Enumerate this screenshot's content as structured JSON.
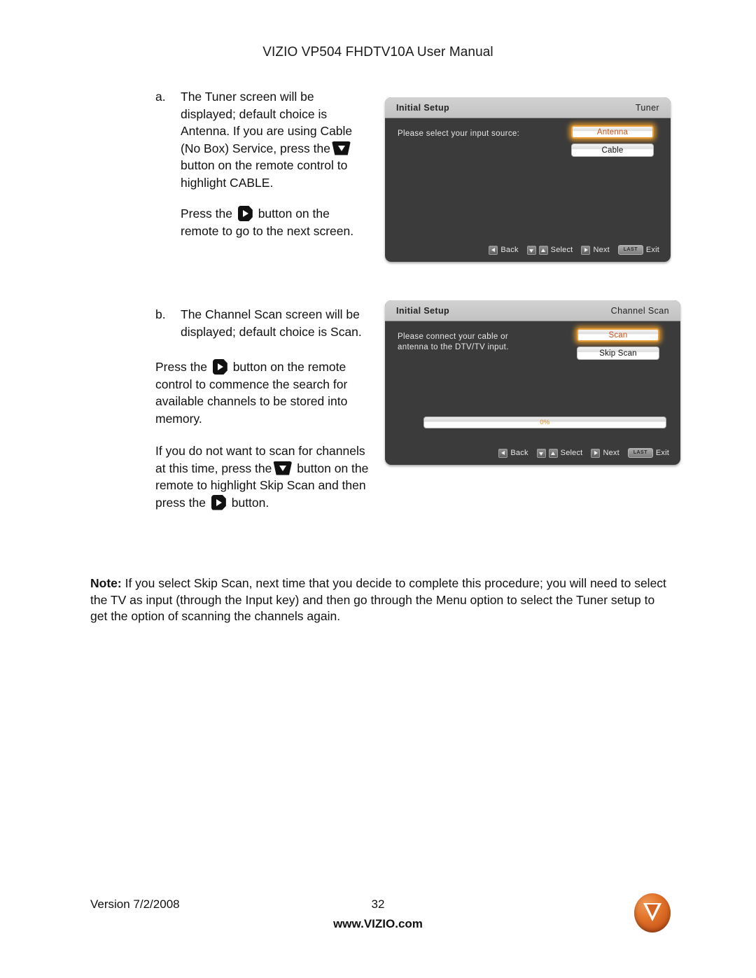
{
  "header": {
    "title": "VIZIO VP504 FHDTV10A User Manual"
  },
  "instructions": {
    "a": {
      "marker": "a.",
      "line1_before": "The Tuner screen will be displayed; default choice is Antenna.  If you are using Cable (No Box) Service, press the",
      "icon1": "down-arrow-key-icon",
      "line1_after": "button on the remote control to highlight CABLE.",
      "line2_before": "Press the",
      "icon2": "right-arrow-key-icon",
      "line2_after": "button on the remote to go to the next screen."
    },
    "b": {
      "marker": "b.",
      "line1": "The Channel Scan screen will be displayed; default choice is Scan.",
      "p1_before": "Press the",
      "p1_icon": "right-arrow-key-icon",
      "p1_after": "button on the remote control to commence the search for available channels to be stored into memory.",
      "p2_before": "If you do not want to scan for channels at this time, press the",
      "p2_icon": "down-arrow-key-icon",
      "p2_mid": "button on the remote to highlight Skip Scan and then press the",
      "p2_icon2": "right-arrow-key-icon",
      "p2_after": "button."
    }
  },
  "osd_tuner": {
    "title_left": "Initial Setup",
    "title_right": "Tuner",
    "prompt": "Please select your input source:",
    "choices": [
      {
        "label": "Antenna",
        "selected": true
      },
      {
        "label": "Cable",
        "selected": false
      }
    ],
    "nav": [
      {
        "icon": "left-arrow-key-icon",
        "label": "Back"
      },
      {
        "icon": "down-up-arrow-keys-icon",
        "label": "Select"
      },
      {
        "icon": "right-arrow-key-icon",
        "label": "Next"
      },
      {
        "icon": "last-key-icon",
        "label": "Exit",
        "key_text": "LAST"
      }
    ]
  },
  "osd_channel_scan": {
    "title_left": "Initial Setup",
    "title_right": "Channel Scan",
    "prompt_line1": "Please connect your cable or",
    "prompt_line2": "antenna to the DTV/TV input.",
    "choices": [
      {
        "label": "Scan",
        "selected": true
      },
      {
        "label": "Skip Scan",
        "selected": false
      }
    ],
    "progress": {
      "label": "0%",
      "percent": 0
    },
    "nav": [
      {
        "icon": "left-arrow-key-icon",
        "label": "Back"
      },
      {
        "icon": "down-up-arrow-keys-icon",
        "label": "Select"
      },
      {
        "icon": "right-arrow-key-icon",
        "label": "Next"
      },
      {
        "icon": "last-key-icon",
        "label": "Exit",
        "key_text": "LAST"
      }
    ]
  },
  "note": {
    "label": "Note:",
    "text": " If you select Skip Scan, next time that you decide to complete this procedure; you will need to select the TV as input (through the Input key) and then go through the Menu option to select the Tuner setup to get the option of scanning the channels again."
  },
  "footer": {
    "version": "Version 7/2/2008",
    "page_number": "32",
    "website": "www.VIZIO.com",
    "logo": "vizio-logo-icon"
  },
  "colors": {
    "accent_orange": "#e39020",
    "selected_text": "#c8541a",
    "osd_body": "#3b3b3b",
    "osd_titlebar": "#c8c8c8"
  }
}
